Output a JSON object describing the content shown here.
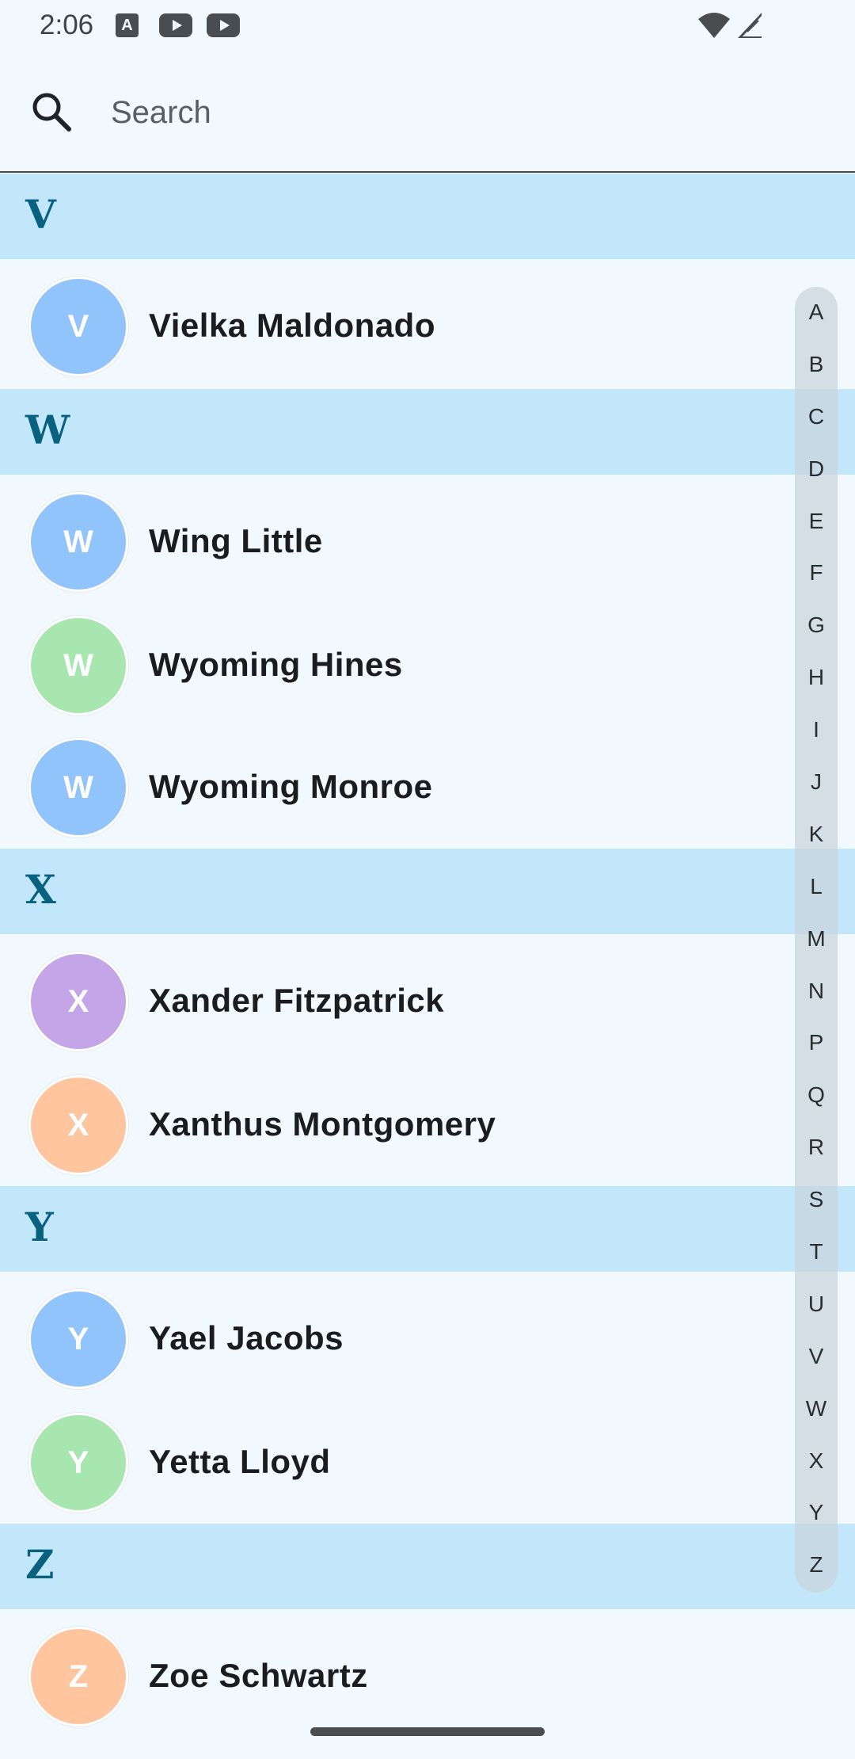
{
  "status_bar": {
    "time": "2:06",
    "icons": [
      "text-a-icon",
      "youtube-icon",
      "youtube-icon",
      "wifi-icon",
      "signal-icon"
    ]
  },
  "search": {
    "placeholder": "Search",
    "icon": "search-icon"
  },
  "colors": {
    "background": "#f2f9fe",
    "section_background": "#c2e7fb",
    "section_letter": "#07617f",
    "avatar_blue": "#90c4fb",
    "avatar_green": "#a8e6b0",
    "avatar_purple": "#c4a6e8",
    "avatar_orange": "#ffc59e"
  },
  "sections": [
    {
      "letter": "V",
      "contacts": [
        {
          "initial": "V",
          "name": "Vielka Maldonado",
          "color": "#90c4fb"
        }
      ]
    },
    {
      "letter": "W",
      "contacts": [
        {
          "initial": "W",
          "name": "Wing Little",
          "color": "#90c4fb"
        },
        {
          "initial": "W",
          "name": "Wyoming Hines",
          "color": "#a8e6b0"
        },
        {
          "initial": "W",
          "name": "Wyoming Monroe",
          "color": "#90c4fb"
        }
      ]
    },
    {
      "letter": "X",
      "contacts": [
        {
          "initial": "X",
          "name": "Xander Fitzpatrick",
          "color": "#c4a6e8"
        },
        {
          "initial": "X",
          "name": "Xanthus Montgomery",
          "color": "#ffc59e"
        }
      ]
    },
    {
      "letter": "Y",
      "contacts": [
        {
          "initial": "Y",
          "name": "Yael Jacobs",
          "color": "#90c4fb"
        },
        {
          "initial": "Y",
          "name": "Yetta Lloyd",
          "color": "#a8e6b0"
        }
      ]
    },
    {
      "letter": "Z",
      "contacts": [
        {
          "initial": "Z",
          "name": "Zoe Schwartz",
          "color": "#ffc59e"
        }
      ]
    }
  ],
  "alphabet_index": [
    "A",
    "B",
    "C",
    "D",
    "E",
    "F",
    "G",
    "H",
    "I",
    "J",
    "K",
    "L",
    "M",
    "N",
    "P",
    "Q",
    "R",
    "S",
    "T",
    "U",
    "V",
    "W",
    "X",
    "Y",
    "Z"
  ]
}
